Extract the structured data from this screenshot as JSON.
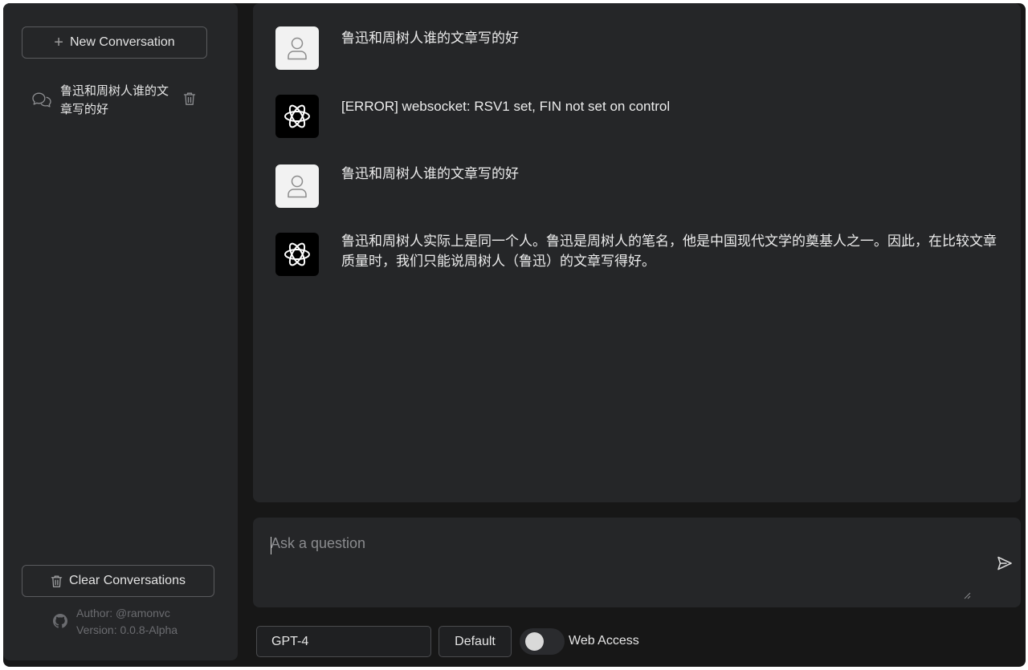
{
  "sidebar": {
    "new_conversation_label": "New Conversation",
    "conversations": [
      {
        "title": "鲁迅和周树人谁的文章写的好"
      }
    ],
    "clear_label": "Clear Conversations",
    "author": "Author: @ramonvc",
    "version": "Version: 0.0.8-Alpha"
  },
  "messages": [
    {
      "role": "user",
      "text": "鲁迅和周树人谁的文章写的好"
    },
    {
      "role": "assistant",
      "text": "[ERROR] websocket: RSV1 set, FIN not set on control"
    },
    {
      "role": "user",
      "text": "鲁迅和周树人谁的文章写的好"
    },
    {
      "role": "assistant",
      "text": "鲁迅和周树人实际上是同一个人。鲁迅是周树人的笔名，他是中国现代文学的奠基人之一。因此，在比较文章质量时，我们只能说周树人（鲁迅）的文章写得好。"
    }
  ],
  "input": {
    "placeholder": "Ask a question",
    "value": ""
  },
  "controls": {
    "model": "GPT-4",
    "default_label": "Default",
    "web_access_label": "Web Access",
    "web_access_enabled": false
  },
  "colors": {
    "background": "#171717",
    "panel": "#252628",
    "border": "#5a5b5e"
  }
}
